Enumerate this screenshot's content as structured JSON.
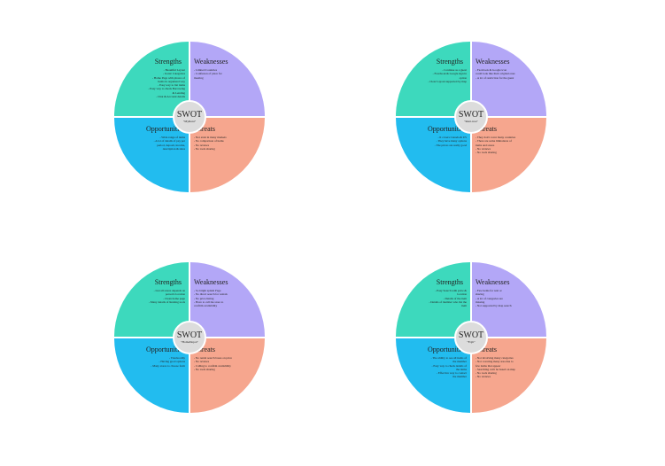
{
  "colors": {
    "strengths": "#3dd9bd",
    "weaknesses": "#b3a7f7",
    "opportunities": "#22bcef",
    "threats": "#f6a68e",
    "center": "#dcdcdc"
  },
  "headings": {
    "strengths": "Strengths",
    "weaknesses": "Weaknesses",
    "opportunities": "Opportunities",
    "threats": "Threats",
    "swot": "SWOT"
  },
  "diagrams": [
    {
      "name": "\"MyRent\"",
      "strengths": [
        "- Beautiful Layout",
        "- Iconic Categories",
        "- Home Page with photos of",
        "items in organized way",
        "- Easy way to list items",
        "- Easy way to check Borrowing",
        "& Lending",
        "- Chat & Account details"
      ],
      "weaknesses": [
        "- Limited Countries",
        "- Confusion of place for",
        "meeting"
      ],
      "opportunities": [
        "- Wide range of items",
        "- A lot of details of pay per",
        "period, deposit, income,",
        "description & rules"
      ],
      "threats": [
        "- Not exist in many markets",
        "- No comparison of items",
        "- No reviews",
        "- No tools sharing"
      ]
    },
    {
      "name": "\"Rent-tree\"",
      "strengths": [
        "- Continue as a guest",
        "- Facebook & Google sign in",
        "option",
        "- Clear Layout supported by map"
      ],
      "weaknesses": [
        "- Facebook & Google icon",
        "could look like their original ones",
        "- A lot of restriction for the guest"
      ],
      "opportunities": [
        "- It covers Canada & US",
        "- They have many options",
        "- The prices are really good"
      ],
      "threats": [
        "- They don't cover many countries",
        "- There are some limitations of",
        "items and stores",
        "- No reviews",
        "- No tools sharing"
      ]
    },
    {
      "name": "\"HomeDepot\"",
      "strengths": [
        "- List all stores depends on",
        "person's location",
        "- Clean home page",
        "- Many details of Renting tools"
      ],
      "weaknesses": [
        "- So bright splash Page",
        "- No direct search for rentals",
        "- No price listing",
        "- Have to call the store to",
        "confirm availability"
      ],
      "opportunities": [
        "- Trustworthy",
        "- Having good options",
        "- Many stores to choose form"
      ],
      "threats": [
        "- No rental search bases on price",
        "- No reviews",
        "- Calling to confirm availability",
        "- No tools sharing"
      ]
    },
    {
      "name": "\"Fojit\"",
      "strengths": [
        "- Easy Search with price &",
        "location",
        "- Details of the item",
        "- Details of member who list the",
        "item"
      ],
      "weaknesses": [
        "- Few items for rent or",
        "sharing",
        "- A lot of categories are",
        "missing",
        "- Not supported by map search"
      ],
      "opportunities": [
        "- The ability to see all items of",
        "the member",
        "- Easy way to check details of",
        "the items",
        "- Effective way to contact",
        "the member"
      ],
      "threats": [
        "- Not involving many categories",
        "- Not covering many area due to",
        "few items that appear",
        "- Searching can't be based on map",
        "- No tools sharing",
        "- No reviews"
      ]
    }
  ]
}
